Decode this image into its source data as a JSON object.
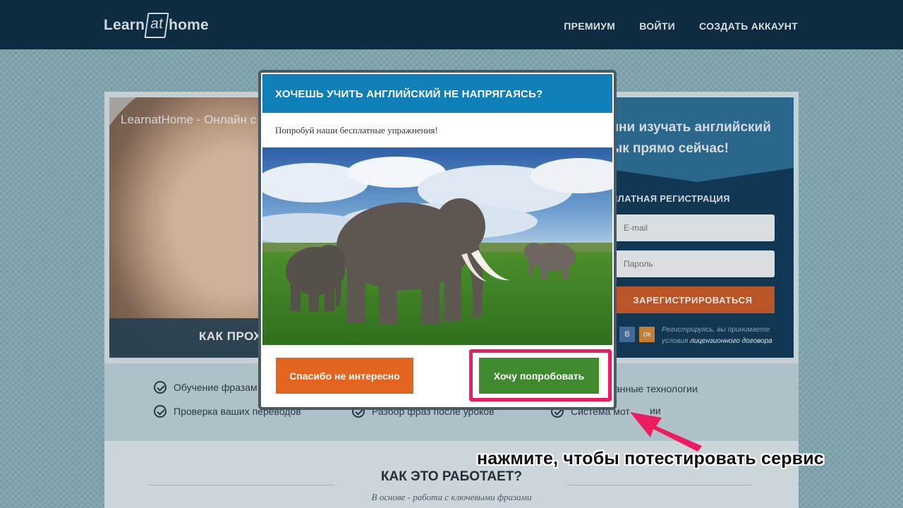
{
  "header": {
    "logo": {
      "left": "Learn",
      "mid": "at",
      "right": "home"
    },
    "nav": [
      "ПРЕМИУМ",
      "ВОЙТИ",
      "СОЗДАТЬ АККАУНТ"
    ]
  },
  "video": {
    "title": "LearnatHome - Онлайн с",
    "bar_text": "КАК ПРОХ"
  },
  "registration": {
    "headline_1": "чни изучать английский",
    "headline_2": "ык прямо сейчас!",
    "subheading": "ПЛАТНАЯ РЕГИСТРАЦИЯ",
    "email_placeholder": "E-mail",
    "password_placeholder": "Пароль",
    "submit_label": "ЗАРЕГИСТРИРОВАТЬСЯ",
    "social": [
      "В",
      "ок"
    ],
    "note_prefix": "Регистрируясь, вы принимаете условия",
    "note_link": "лицензионного договора"
  },
  "features": [
    "Обучение фразам,",
    "анные технологии",
    "Проверка ваших переводов",
    "Разбор фраз после уроков",
    "Система мот",
    "ии"
  ],
  "how": {
    "title": "КАК ЭТО РАБОТАЕТ?",
    "subtitle": "В основе - работа с ключевыми фразами"
  },
  "modal": {
    "title": "ХОЧЕШЬ УЧИТЬ АНГЛИЙСКИЙ НЕ НАПРЯГАЯСЬ?",
    "text": "Попробуй наши бесплатные упражнения!",
    "decline_label": "Спасибо не интересно",
    "accept_label": "Хочу попробовать"
  },
  "annotation": {
    "callout": "нажмите, чтобы потестировать сервис",
    "highlight_color": "#ee1c5f"
  },
  "colors": {
    "header_bg": "#0e2c3f",
    "modal_header": "#0f7fb7",
    "decline": "#e2641e",
    "accept": "#3f8a2e",
    "register": "#d25c25"
  }
}
